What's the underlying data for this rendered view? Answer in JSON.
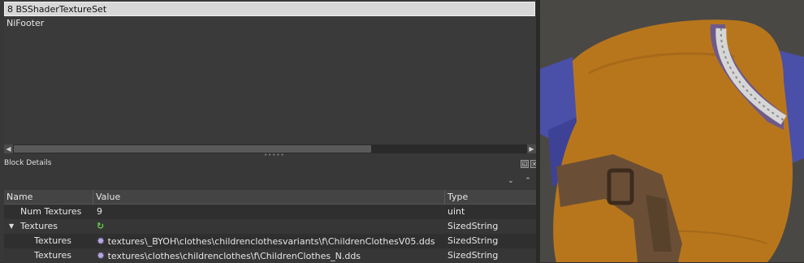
{
  "block_list": {
    "items": [
      {
        "label": "8 BSShaderTextureSet",
        "selected": true
      },
      {
        "label": "NiFooter",
        "selected": false
      }
    ]
  },
  "details": {
    "title": "Block Details",
    "columns": [
      "Name",
      "Value",
      "Type"
    ],
    "rows": [
      {
        "name": "Num Textures",
        "value": "9",
        "type": "uint",
        "icon": "",
        "expander": ""
      },
      {
        "name": "Textures",
        "value": "",
        "type": "SizedString",
        "icon": "refresh-icon",
        "expander": "▼"
      },
      {
        "name": "Textures",
        "value": "textures\\_BYOH\\clothes\\childrenclothesvariants\\f\\ChildrenClothesV05.dds",
        "type": "SizedString",
        "icon": "texture-gear-icon",
        "expander": ""
      },
      {
        "name": "Textures",
        "value": "textures\\clothes\\childrenclothes\\f\\ChildrenClothes_N.dds",
        "type": "SizedString",
        "icon": "texture-gear-icon",
        "expander": ""
      }
    ]
  },
  "colors": {
    "shirt": "#b8761c",
    "sleeve": "#4a4fa8",
    "belt": "#6a4f36",
    "collar": "#d6d6d6",
    "background": "#4a4845"
  }
}
